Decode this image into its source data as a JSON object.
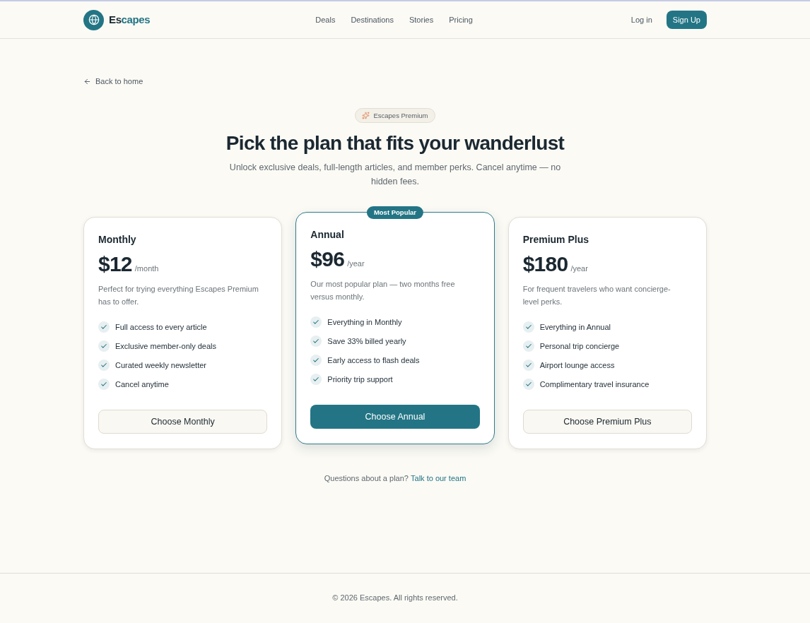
{
  "header": {
    "logo": {
      "parts": [
        {
          "text": "Es",
          "accent": false
        },
        {
          "text": "capes",
          "accent": true
        }
      ]
    },
    "nav": [
      "Deals",
      "Destinations",
      "Stories",
      "Pricing"
    ],
    "login": "Log in",
    "signup": "Sign Up"
  },
  "back_link": "Back to home",
  "hero": {
    "badge": "Escapes Premium",
    "title": "Pick the plan that fits your wanderlust",
    "subtitle": "Unlock exclusive deals, full-length articles, and member perks. Cancel anytime — no hidden fees."
  },
  "plans": [
    {
      "name": "Monthly",
      "price": "$12",
      "period": "/month",
      "description": "Perfect for trying everything Escapes Premium has to offer.",
      "features": [
        "Full access to every article",
        "Exclusive member-only deals",
        "Curated weekly newsletter",
        "Cancel anytime"
      ],
      "button": "Choose Monthly",
      "featured": false
    },
    {
      "name": "Annual",
      "ribbon": "Most Popular",
      "price": "$96",
      "period": "/year",
      "description": "Our most popular plan — two months free versus monthly.",
      "features": [
        "Everything in Monthly",
        "Save 33% billed yearly",
        "Early access to flash deals",
        "Priority trip support"
      ],
      "button": "Choose Annual",
      "featured": true
    },
    {
      "name": "Premium Plus",
      "price": "$180",
      "period": "/year",
      "description": "For frequent travelers who want concierge-level perks.",
      "features": [
        "Everything in Annual",
        "Personal trip concierge",
        "Airport lounge access",
        "Complimentary travel insurance"
      ],
      "button": "Choose Premium Plus",
      "featured": false
    }
  ],
  "contact": {
    "text": "Questions about a plan?",
    "link": "Talk to our team"
  },
  "footer": {
    "copyright": "© 2026 Escapes. All rights reserved."
  }
}
